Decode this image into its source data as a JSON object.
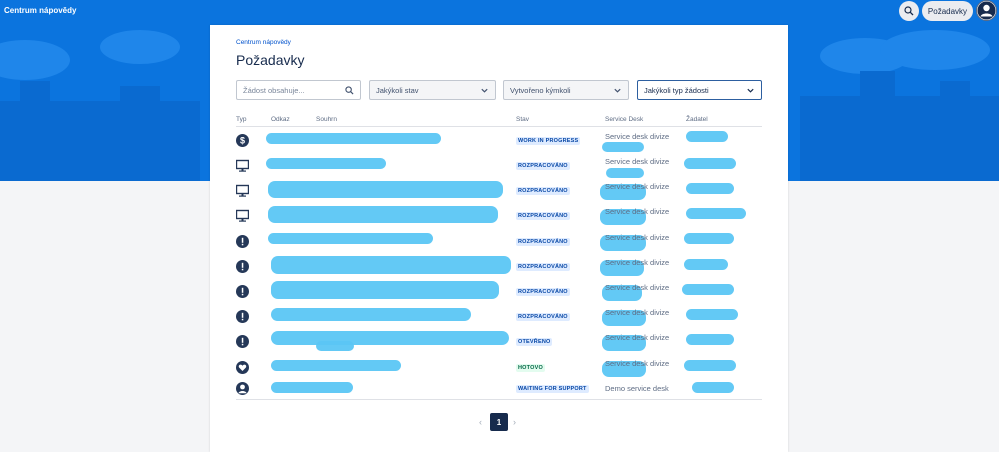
{
  "header": {
    "site_title": "Centrum nápovědy",
    "requests_label": "Požadavky",
    "search_icon": "search-icon",
    "avatar_icon": "user-avatar-icon"
  },
  "breadcrumb": "Centrum nápovědy",
  "page_title": "Požadavky",
  "filters": {
    "search_placeholder": "Žádost obsahuje...",
    "status": "Jakýkoli stav",
    "created_by": "Vytvořeno kýmkoli",
    "request_type": "Jakýkoli typ žádosti"
  },
  "table": {
    "headers": [
      "Typ",
      "Odkaz",
      "Souhrn",
      "Stav",
      "Service Desk",
      "Žadatel"
    ],
    "rows": [
      {
        "type_icon": "dollar-icon",
        "status": "WORK IN PROGRESS",
        "status_color": "blue",
        "service_desk": "Service desk divize"
      },
      {
        "type_icon": "monitor-icon",
        "status": "ROZPRACOVÁNO",
        "status_color": "blue",
        "service_desk": "Service desk divize"
      },
      {
        "type_icon": "monitor-icon",
        "status": "ROZPRACOVÁNO",
        "status_color": "blue",
        "service_desk": "Service desk divize"
      },
      {
        "type_icon": "monitor-icon",
        "status": "ROZPRACOVÁNO",
        "status_color": "blue",
        "service_desk": "Service desk divize"
      },
      {
        "type_icon": "alert-icon",
        "status": "ROZPRACOVÁNO",
        "status_color": "blue",
        "service_desk": "Service desk divize"
      },
      {
        "type_icon": "alert-icon",
        "status": "ROZPRACOVÁNO",
        "status_color": "blue",
        "service_desk": "Service desk divize"
      },
      {
        "type_icon": "alert-icon",
        "status": "ROZPRACOVÁNO",
        "status_color": "blue",
        "service_desk": "Service desk divize"
      },
      {
        "type_icon": "alert-icon",
        "status": "ROZPRACOVÁNO",
        "status_color": "blue",
        "service_desk": "Service desk divize"
      },
      {
        "type_icon": "alert-icon",
        "status": "OTEVŘENO",
        "status_color": "blue",
        "service_desk": "Service desk divize"
      },
      {
        "type_icon": "heart-icon",
        "status": "HOTOVO",
        "status_color": "green",
        "service_desk": "Service desk divize"
      },
      {
        "type_icon": "person-icon",
        "status": "WAITING FOR SUPPORT",
        "status_color": "blue",
        "service_desk": "Demo service desk"
      }
    ]
  },
  "pagination": {
    "current_page": "1",
    "prev_label": "‹",
    "next_label": "›"
  },
  "colors": {
    "banner": "#0b74de",
    "redaction": "#5bc6f4",
    "link": "#0052cc"
  }
}
